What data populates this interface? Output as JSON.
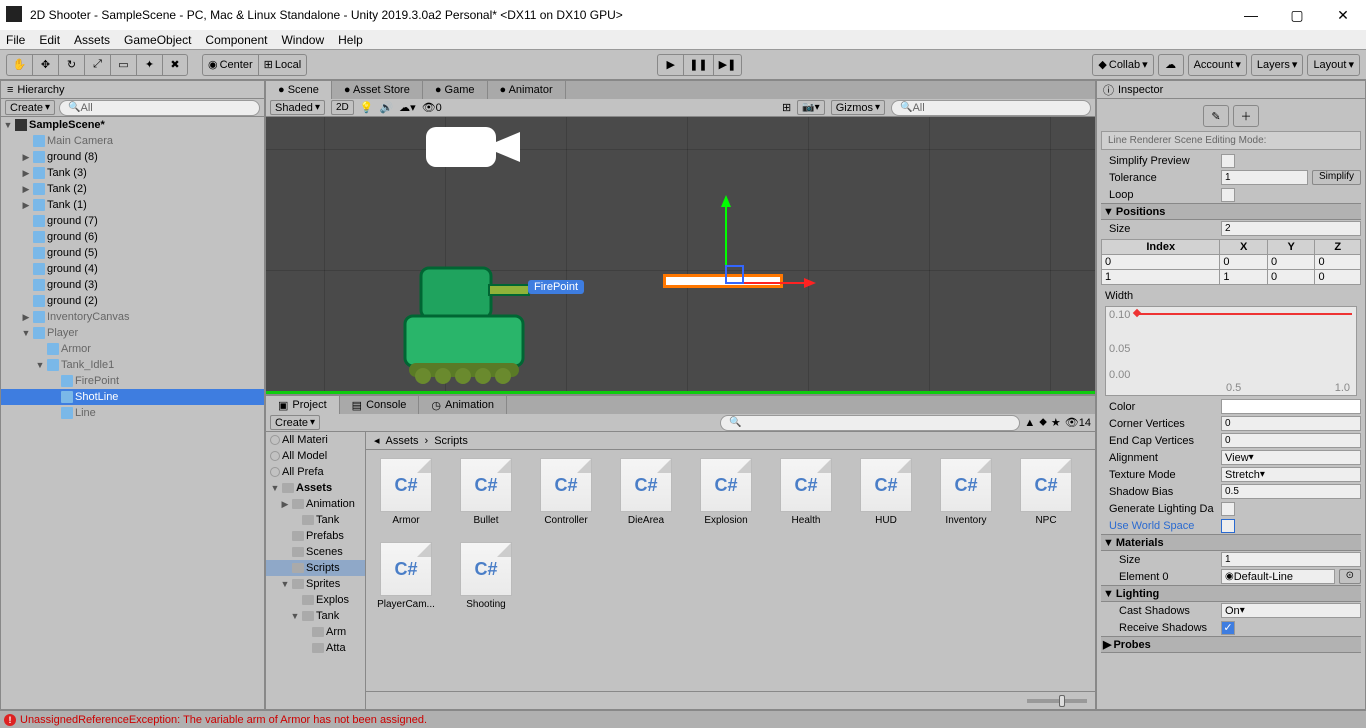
{
  "window": {
    "title": "2D Shooter - SampleScene - PC, Mac & Linux Standalone - Unity 2019.3.0a2 Personal* <DX11 on DX10 GPU>"
  },
  "menu": [
    "File",
    "Edit",
    "Assets",
    "GameObject",
    "Component",
    "Window",
    "Help"
  ],
  "toolbar": {
    "center": "Center",
    "local": "Local",
    "collab": "Collab",
    "account": "Account",
    "layers": "Layers",
    "layout": "Layout"
  },
  "hierarchy": {
    "tab": "Hierarchy",
    "create": "Create",
    "search_ph": "All",
    "scene": "SampleScene*",
    "items": [
      {
        "name": "Main Camera",
        "indent": 1,
        "icon": "cube",
        "dim": true
      },
      {
        "name": "ground (8)",
        "indent": 1,
        "icon": "cube",
        "fold": "▶"
      },
      {
        "name": "Tank (3)",
        "indent": 1,
        "icon": "cube",
        "fold": "▶"
      },
      {
        "name": "Tank (2)",
        "indent": 1,
        "icon": "cube",
        "fold": "▶"
      },
      {
        "name": "Tank (1)",
        "indent": 1,
        "icon": "cube",
        "fold": "▶"
      },
      {
        "name": "ground (7)",
        "indent": 1,
        "icon": "cube"
      },
      {
        "name": "ground (6)",
        "indent": 1,
        "icon": "cube"
      },
      {
        "name": "ground (5)",
        "indent": 1,
        "icon": "cube"
      },
      {
        "name": "ground (4)",
        "indent": 1,
        "icon": "cube"
      },
      {
        "name": "ground (3)",
        "indent": 1,
        "icon": "cube"
      },
      {
        "name": "ground (2)",
        "indent": 1,
        "icon": "cube"
      },
      {
        "name": "InventoryCanvas",
        "indent": 1,
        "icon": "cube",
        "fold": "▶",
        "dim": true
      },
      {
        "name": "Player",
        "indent": 1,
        "icon": "cube",
        "fold": "▼",
        "dim": true
      },
      {
        "name": "Armor",
        "indent": 2,
        "icon": "cube",
        "dim": true
      },
      {
        "name": "Tank_Idle1",
        "indent": 2,
        "icon": "cube",
        "fold": "▼",
        "dim": true
      },
      {
        "name": "FirePoint",
        "indent": 3,
        "icon": "cube",
        "dim": true
      },
      {
        "name": "ShotLine",
        "indent": 3,
        "icon": "cube",
        "sel": true
      },
      {
        "name": "Line",
        "indent": 3,
        "icon": "cube",
        "dim": true
      }
    ]
  },
  "scene": {
    "tabs": [
      {
        "label": "Scene",
        "icon": "scene",
        "active": true
      },
      {
        "label": "Asset Store",
        "icon": "store"
      },
      {
        "label": "Game",
        "icon": "game"
      },
      {
        "label": "Animator",
        "icon": "anim"
      }
    ],
    "shaded": "Shaded",
    "mode2d": "2D",
    "gizmos": "Gizmos",
    "search_ph": "All",
    "audio_zero": "0",
    "firepoint_label": "FirePoint"
  },
  "project": {
    "tabs": [
      "Project",
      "Console",
      "Animation"
    ],
    "create": "Create",
    "count": "14",
    "left_tree": [
      {
        "name": "All Materi",
        "icon": "mag"
      },
      {
        "name": "All Model",
        "icon": "mag"
      },
      {
        "name": "All Prefa",
        "icon": "mag"
      },
      {
        "name": "Assets",
        "icon": "folder",
        "bold": true,
        "fold": "▼"
      },
      {
        "name": "Animation",
        "icon": "folder",
        "fold": "▶",
        "indent": 1
      },
      {
        "name": "Tank",
        "icon": "folder",
        "indent": 2
      },
      {
        "name": "Prefabs",
        "icon": "folder",
        "indent": 1
      },
      {
        "name": "Scenes",
        "icon": "folder",
        "indent": 1
      },
      {
        "name": "Scripts",
        "icon": "folder",
        "indent": 1,
        "sel": true
      },
      {
        "name": "Sprites",
        "icon": "folder",
        "fold": "▼",
        "indent": 1
      },
      {
        "name": "Explos",
        "icon": "folder",
        "indent": 2
      },
      {
        "name": "Tank",
        "icon": "folder",
        "fold": "▼",
        "indent": 2
      },
      {
        "name": "Arm",
        "icon": "folder",
        "indent": 3
      },
      {
        "name": "Atta",
        "icon": "folder",
        "indent": 3
      }
    ],
    "crumb": [
      "Assets",
      "Scripts"
    ],
    "files": [
      "Armor",
      "Bullet",
      "Controller",
      "DieArea",
      "Explosion",
      "Health",
      "HUD",
      "Inventory",
      "NPC",
      "PlayerCam...",
      "Shooting"
    ]
  },
  "inspector": {
    "tab": "Inspector",
    "scene_mode": "Line Renderer Scene Editing Mode:",
    "simplify_preview": "Simplify Preview",
    "tolerance_lbl": "Tolerance",
    "tolerance_val": "1",
    "simplify_btn": "Simplify",
    "loop": "Loop",
    "positions": "Positions",
    "size_lbl": "Size",
    "size_val": "2",
    "cols": [
      "Index",
      "X",
      "Y",
      "Z"
    ],
    "rows": [
      [
        "0",
        "0",
        "0",
        "0"
      ],
      [
        "1",
        "1",
        "0",
        "0"
      ]
    ],
    "width_lbl": "Width",
    "graph_y": [
      "0.10",
      "0.05",
      "0.00"
    ],
    "graph_x": [
      "",
      "0.5",
      "1.0"
    ],
    "color": "Color",
    "corner_v_lbl": "Corner Vertices",
    "corner_v_val": "0",
    "end_v_lbl": "End Cap Vertices",
    "end_v_val": "0",
    "alignment_lbl": "Alignment",
    "alignment_val": "View",
    "texmode_lbl": "Texture Mode",
    "texmode_val": "Stretch",
    "shadowbias_lbl": "Shadow Bias",
    "shadowbias_val": "0.5",
    "genlight": "Generate Lighting Da",
    "useworld": "Use World Space",
    "materials": "Materials",
    "mat_size_lbl": "Size",
    "mat_size_val": "1",
    "elem0_lbl": "Element 0",
    "elem0_val": "Default-Line",
    "lighting": "Lighting",
    "castshadows_lbl": "Cast Shadows",
    "castshadows_val": "On",
    "recvshadows": "Receive Shadows",
    "probes": "Probes"
  },
  "status": {
    "error": "UnassignedReferenceException: The variable arm of Armor has not been assigned."
  }
}
